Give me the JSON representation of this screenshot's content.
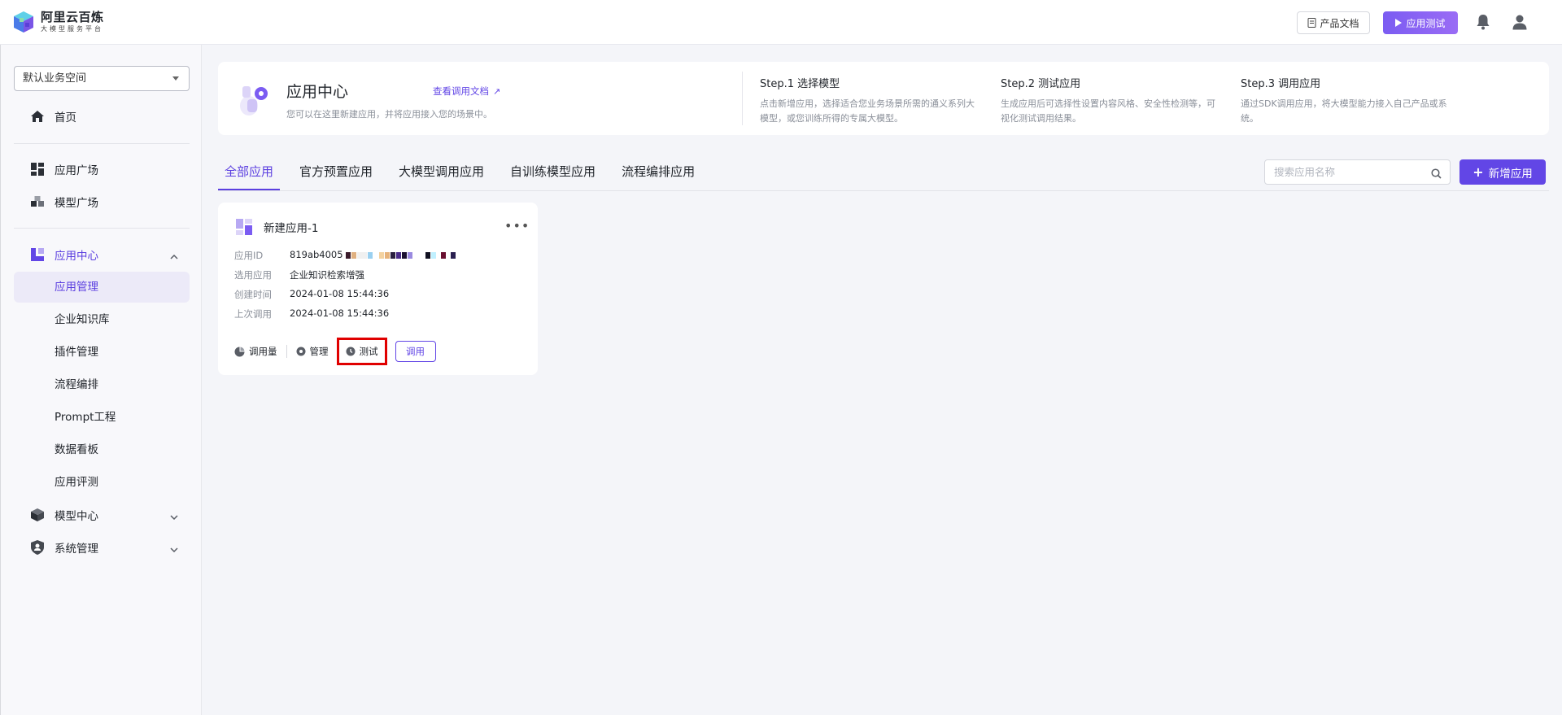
{
  "brand": {
    "title": "阿里云百炼",
    "subtitle": "大模型服务平台"
  },
  "header": {
    "doc_label": "产品文档",
    "test_label": "应用测试"
  },
  "sidebar": {
    "workspace": "默认业务空间",
    "items": [
      {
        "label": "首页"
      },
      {
        "label": "应用广场"
      },
      {
        "label": "模型广场"
      },
      {
        "label": "应用中心"
      },
      {
        "label": "应用管理"
      },
      {
        "label": "企业知识库"
      },
      {
        "label": "插件管理"
      },
      {
        "label": "流程编排"
      },
      {
        "label": "Prompt工程"
      },
      {
        "label": "数据看板"
      },
      {
        "label": "应用评测"
      },
      {
        "label": "模型中心"
      },
      {
        "label": "系统管理"
      }
    ]
  },
  "banner": {
    "title": "应用中心",
    "desc": "您可以在这里新建应用，并将应用接入您的场景中。",
    "link": "查看调用文档",
    "steps": [
      {
        "title": "Step.1 选择模型",
        "desc": "点击新增应用，选择适合您业务场景所需的通义系列大模型，或您训练所得的专属大模型。"
      },
      {
        "title": "Step.2 测试应用",
        "desc": "生成应用后可选择性设置内容风格、安全性检测等，可视化测试调用结果。"
      },
      {
        "title": "Step.3 调用应用",
        "desc": "通过SDK调用应用，将大模型能力接入自己产品或系统。"
      }
    ]
  },
  "tabs": [
    "全部应用",
    "官方预置应用",
    "大模型调用应用",
    "自训练模型应用",
    "流程编排应用"
  ],
  "search": {
    "placeholder": "搜索应用名称"
  },
  "add_label": "新增应用",
  "card": {
    "title": "新建应用-1",
    "id_label": "应用ID",
    "id_value": "819ab4005",
    "app_label": "选用应用",
    "app_value": "企业知识检索增强",
    "created_label": "创建时间",
    "created_value": "2024-01-08 15:44:36",
    "last_label": "上次调用",
    "last_value": "2024-01-08 15:44:36",
    "actions": {
      "usage": "调用量",
      "manage": "管理",
      "test": "测试",
      "call": "调用"
    }
  },
  "colors": {
    "accent": "#6246e6",
    "highlight": "#e00000"
  }
}
